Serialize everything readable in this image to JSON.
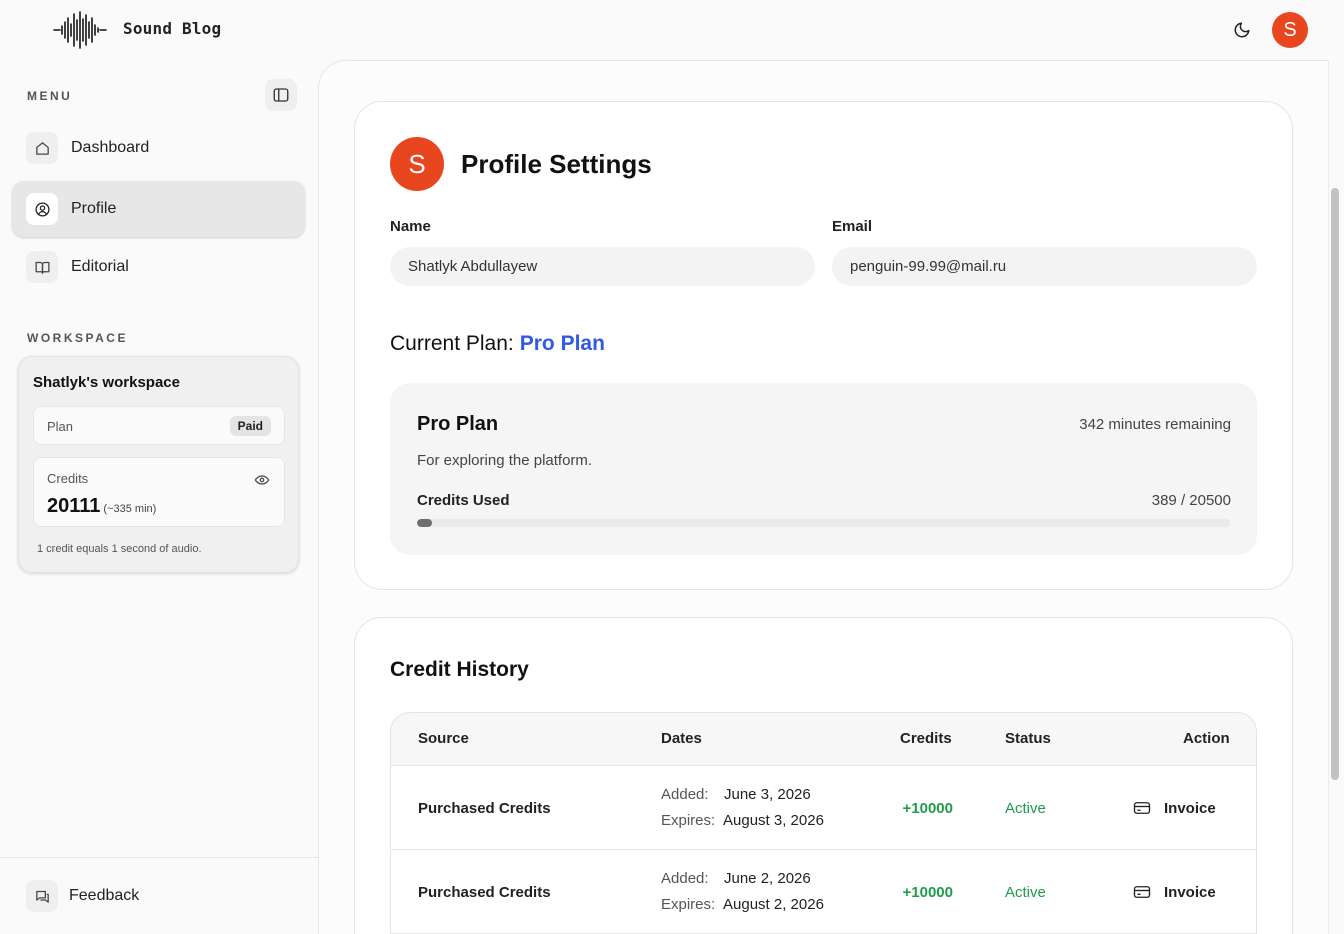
{
  "header": {
    "brand": "Sound Blog"
  },
  "colors": {
    "accent": "#e8461e",
    "plan_link": "#2f5be0",
    "positive": "#1f9d4a"
  },
  "sidebar": {
    "menu_label": "MENU",
    "items": [
      {
        "label": "Dashboard",
        "icon": "home-icon"
      },
      {
        "label": "Profile",
        "icon": "user-circle-icon",
        "active": true
      },
      {
        "label": "Editorial",
        "icon": "book-icon"
      }
    ],
    "workspace_label": "WORKSPACE",
    "workspace": {
      "name": "Shatlyk's workspace",
      "plan_label": "Plan",
      "plan_badge": "Paid",
      "credits_label": "Credits",
      "credits_value": "20111",
      "credits_minutes": "(~335 min)",
      "note": "1 credit equals 1 second of audio."
    },
    "feedback_label": "Feedback"
  },
  "user": {
    "initial": "S"
  },
  "profile": {
    "title": "Profile Settings",
    "name_label": "Name",
    "name_value": "Shatlyk Abdullayew",
    "email_label": "Email",
    "email_value": "penguin-99.99@mail.ru",
    "current_plan_label": "Current Plan:",
    "current_plan_value": "Pro Plan",
    "plan": {
      "name": "Pro Plan",
      "remaining": "342 minutes remaining",
      "description": "For exploring the platform.",
      "credits_used_label": "Credits Used",
      "credits_used_text": "389 / 20500",
      "credits_used_fraction": 0.019
    }
  },
  "history": {
    "title": "Credit History",
    "columns": {
      "source": "Source",
      "dates": "Dates",
      "credits": "Credits",
      "status": "Status",
      "action": "Action"
    },
    "added_label": "Added:",
    "expires_label": "Expires:",
    "rows": [
      {
        "source": "Purchased Credits",
        "added": "June 3, 2026",
        "expires": "August 3, 2026",
        "credits": "+10000",
        "status": "Active",
        "action": "Invoice"
      },
      {
        "source": "Purchased Credits",
        "added": "June 2, 2026",
        "expires": "August 2, 2026",
        "credits": "+10000",
        "status": "Active",
        "action": "Invoice"
      }
    ]
  }
}
